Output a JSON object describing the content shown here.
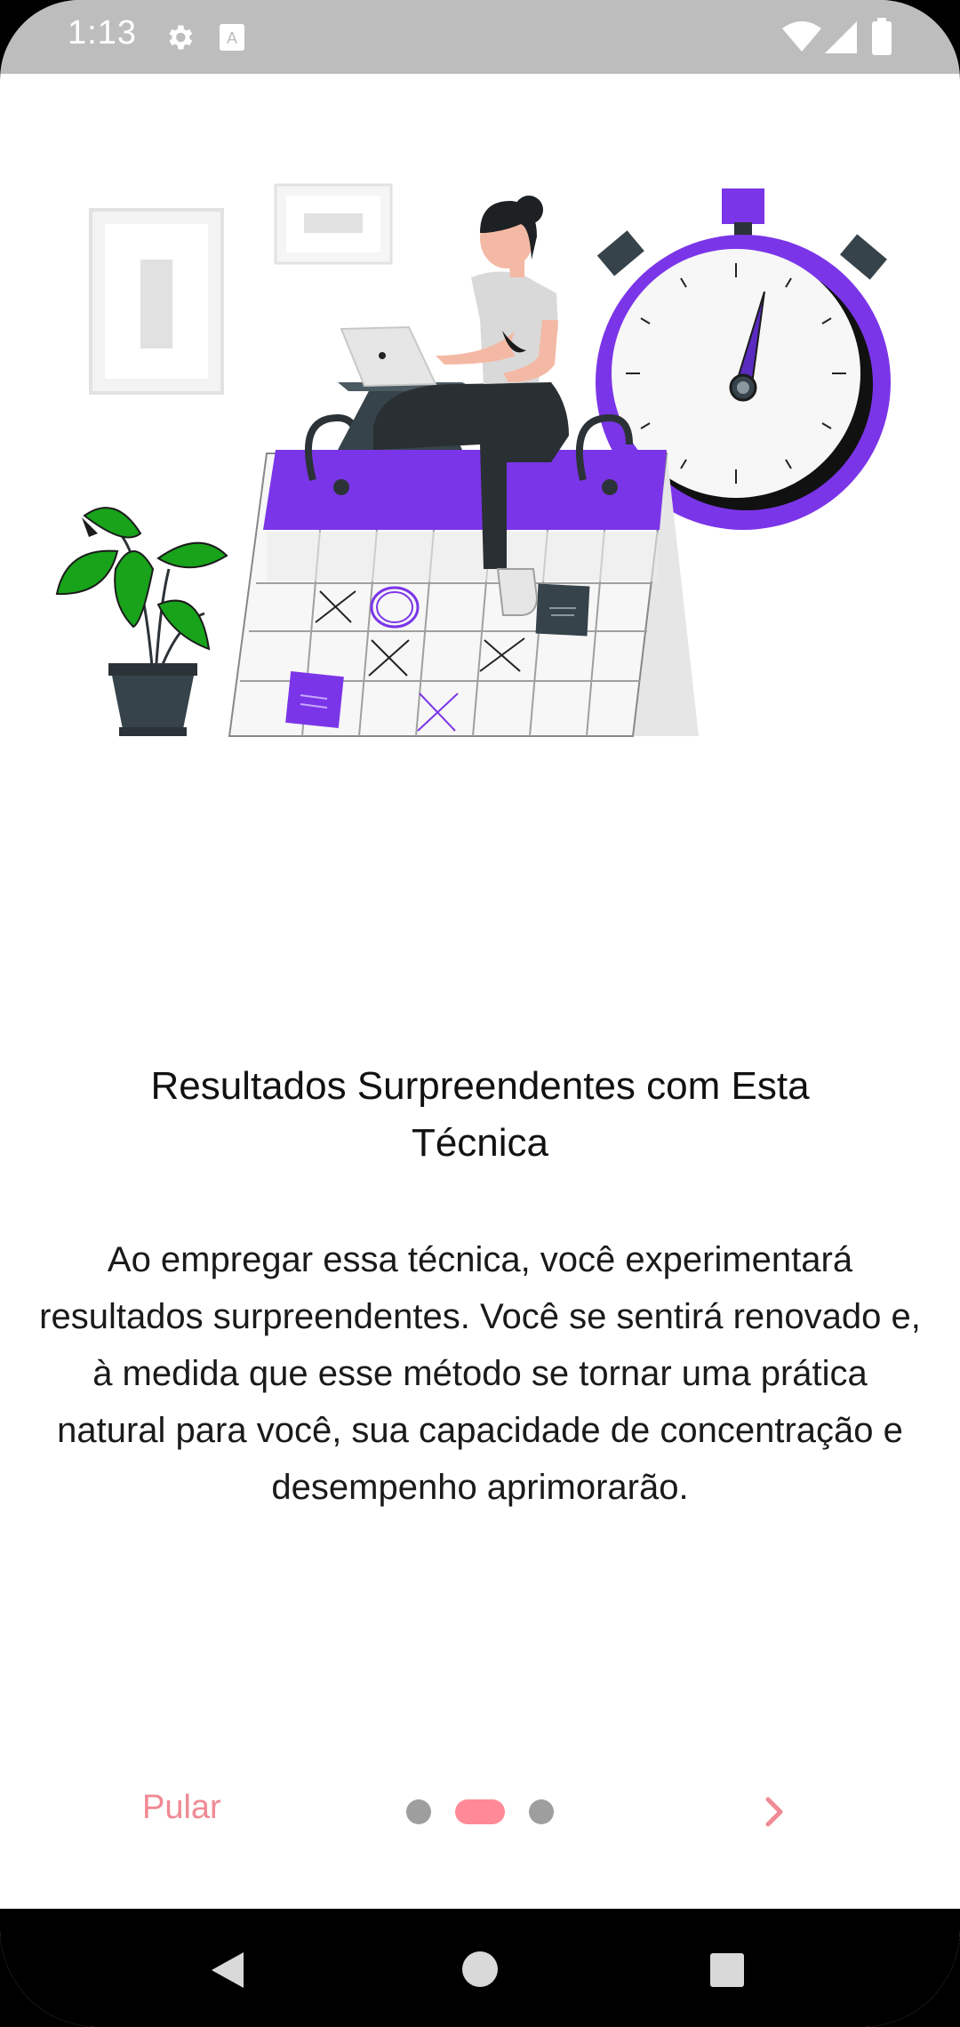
{
  "status_bar": {
    "time": "1:13",
    "icons": [
      "gear-icon",
      "text-a-icon",
      "wifi-icon",
      "signal-icon",
      "battery-icon"
    ]
  },
  "onboarding": {
    "illustration": "woman-working-on-calendar-with-stopwatch",
    "title": "Resultados Surpreendentes com Esta Técnica",
    "body": "Ao empregar essa técnica, você experimentará resultados surpreendentes. Você se sentirá renovado e, à medida que esse método se tornar uma prática natural para você, sua capacidade de concentração e desempenho aprimorarão.",
    "skip_label": "Pular",
    "page_indicator": {
      "total": 3,
      "active": 2
    },
    "next_icon": "chevron-right-icon"
  },
  "nav_bar": {
    "icons": [
      "back-icon",
      "home-icon",
      "recents-icon"
    ]
  },
  "colors": {
    "accent": "#ff8a96",
    "skip_text": "#f08a94",
    "purple": "#7b35e8",
    "status_bar": "#bdbdbd"
  }
}
